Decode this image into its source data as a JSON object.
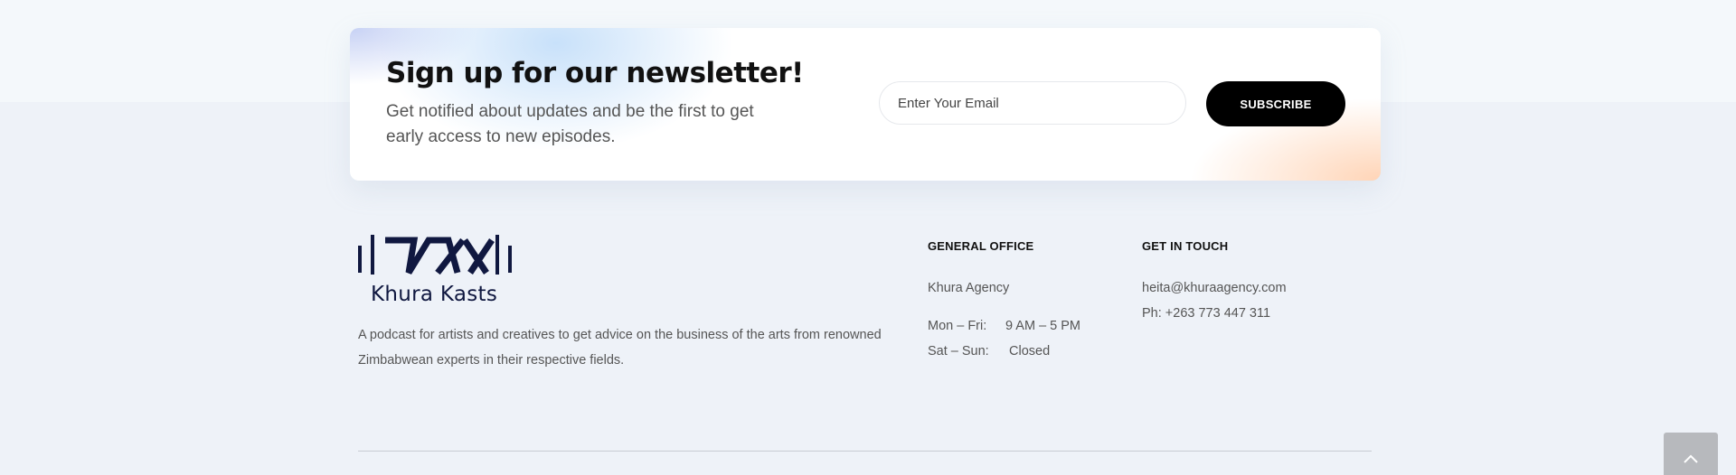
{
  "newsletter": {
    "title": "Sign up for our newsletter!",
    "subtitle": "Get notified about updates and be the first to get early access to new episodes.",
    "email_placeholder": "Enter Your Email",
    "email_value": "",
    "subscribe_label": "SUBSCRIBE"
  },
  "brand": {
    "name": "Khura Kasts",
    "logo_icon": "khura-kasts-logo",
    "description": "A podcast for artists and creatives to get advice on the business of the arts from renowned Zimbabwean experts in their respective fields."
  },
  "general_office": {
    "title": "GENERAL OFFICE",
    "name": "Khura Agency",
    "hours": [
      {
        "days": "Mon – Fri:",
        "time": "9 AM – 5 PM"
      },
      {
        "days": "Sat – Sun:",
        "time": "Closed"
      }
    ]
  },
  "get_in_touch": {
    "title": "GET IN TOUCH",
    "email": "heita@khuraagency.com",
    "phone": "Ph: +263 773 447 311"
  },
  "back_to_top": {
    "icon": "chevron-up-icon"
  },
  "colors": {
    "accent_dark": "#101840",
    "button_bg": "#000000",
    "page_bg": "#eef2f8"
  }
}
